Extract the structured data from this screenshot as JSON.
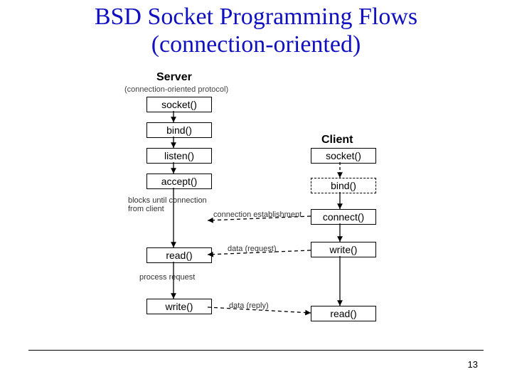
{
  "title_line1": "BSD Socket Programming Flows",
  "title_line2": "(connection-oriented)",
  "server": {
    "heading": "Server",
    "subheading": "(connection-oriented protocol)",
    "nodes": {
      "socket": "socket()",
      "bind": "bind()",
      "listen": "listen()",
      "accept": "accept()",
      "read": "read()",
      "write": "write()"
    },
    "notes": {
      "blocks": "blocks until connection\nfrom client",
      "process": "process request"
    }
  },
  "client": {
    "heading": "Client",
    "nodes": {
      "socket": "socket()",
      "bind": "bind()",
      "connect": "connect()",
      "write": "write()",
      "read": "read()"
    }
  },
  "edge_labels": {
    "establish": "connection establishment",
    "request": "data (request)",
    "reply": "data (reply)"
  },
  "page_number": "13"
}
